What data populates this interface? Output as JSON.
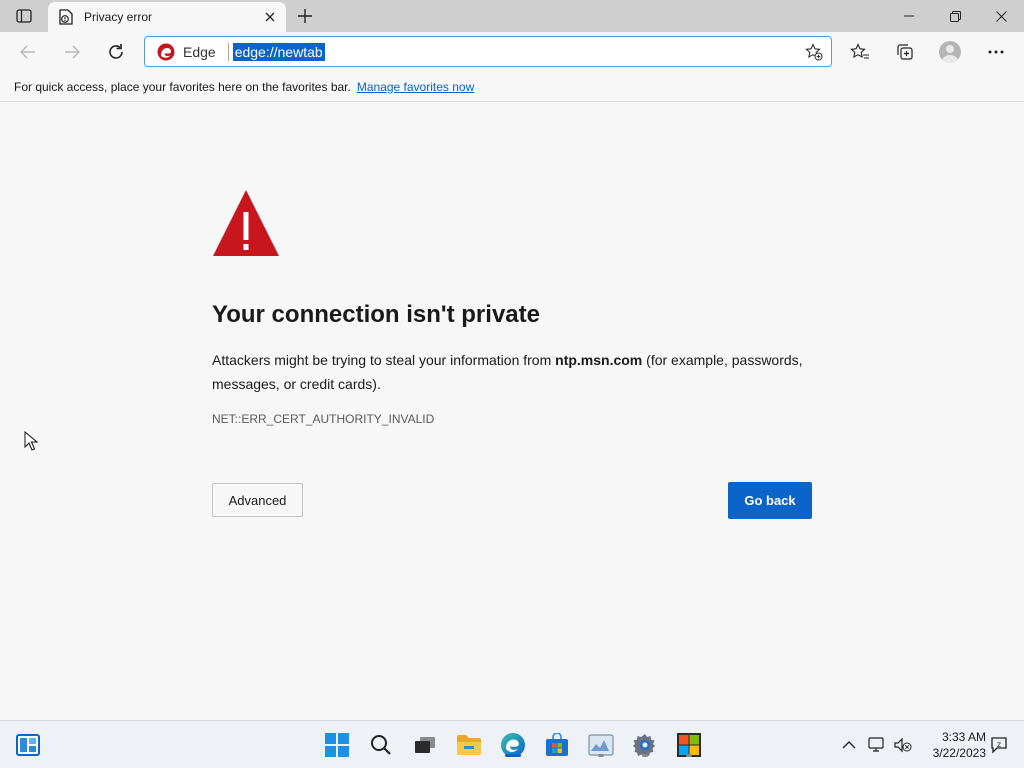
{
  "tab": {
    "title": "Privacy error"
  },
  "address_bar": {
    "site_label": "Edge",
    "url": "edge://newtab"
  },
  "favorites_bar": {
    "message": "For quick access, place your favorites here on the favorites bar.",
    "link": "Manage favorites now"
  },
  "error_page": {
    "title": "Your connection isn't private",
    "body_prefix": "Attackers might be trying to steal your information from ",
    "body_host": "ntp.msn.com",
    "body_suffix": " (for example, passwords, messages, or credit cards).",
    "error_code": "NET::ERR_CERT_AUTHORITY_INVALID",
    "advanced_label": "Advanced",
    "go_back_label": "Go back"
  },
  "taskbar": {
    "time": "3:33 AM",
    "date": "3/22/2023"
  },
  "colors": {
    "accent": "#0a64c9",
    "warning_red": "#c8161e",
    "link": "#0b63c5"
  }
}
